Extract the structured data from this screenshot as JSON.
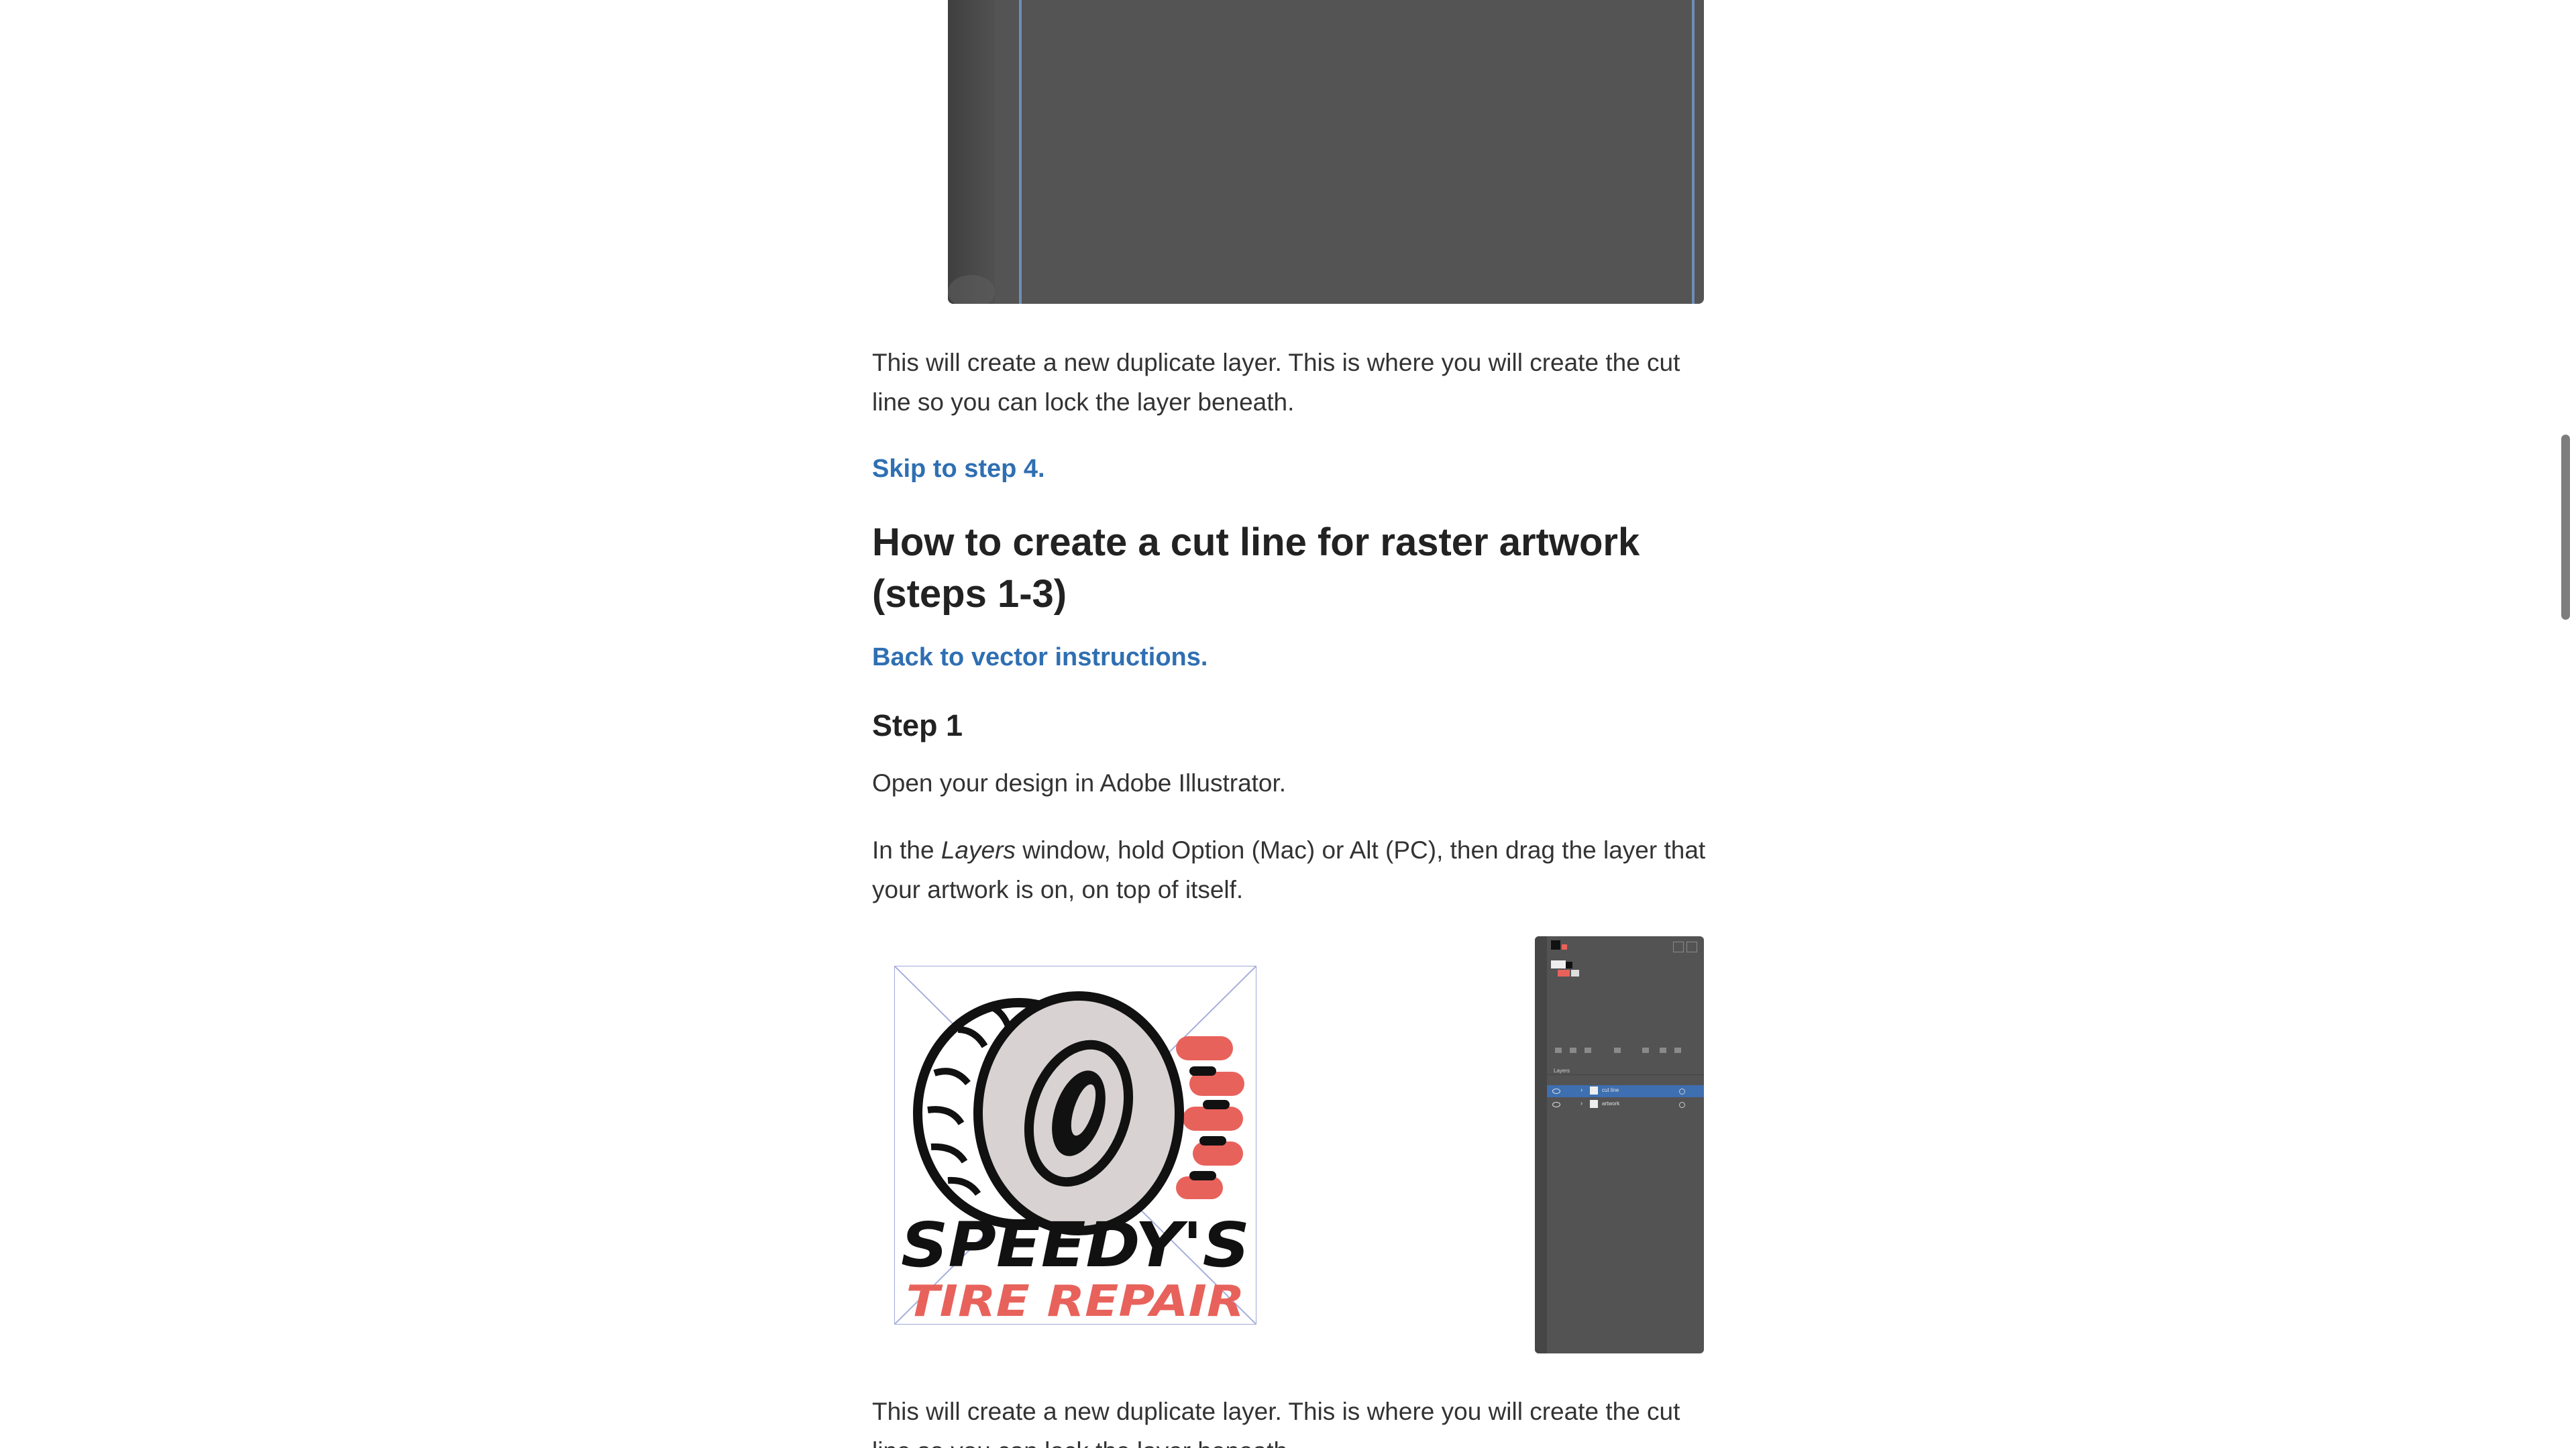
{
  "paragraphs": {
    "p1_line1": "This will create a new duplicate layer. This is where you will create the cut",
    "p1_line2": "line so you can lock the layer beneath.",
    "p2": "Open your design in Adobe Illustrator.",
    "p3_pre": "In the ",
    "p3_em": "Layers",
    "p3_post_line1": " window, hold Option (Mac) or Alt (PC), then drag the layer that",
    "p3_line2": "your artwork is on, on top of itself.",
    "p4_line1": "This will create a new duplicate layer. This is where you will create the cut",
    "p4_line2": "line so you can lock the layer beneath."
  },
  "links": {
    "skip": "Skip to step 4.",
    "back": "Back to vector instructions."
  },
  "headings": {
    "raster_line1": "How to create a cut line for raster artwork",
    "raster_line2": "(steps 1-3)",
    "step1": "Step 1"
  },
  "logo": {
    "line1": "SPEEDY'S",
    "line2": "TIRE REPAIR"
  },
  "layers_panel": {
    "title": "Layers",
    "rows": [
      "cut line",
      "artwork"
    ]
  },
  "colors": {
    "link": "#2f6fb2",
    "logo_accent": "#e8625c",
    "panel_bg": "#535353",
    "selection": "#3e6fb0"
  }
}
